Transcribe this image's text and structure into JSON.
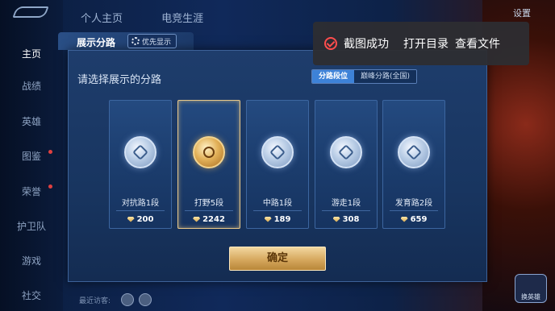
{
  "nav": {
    "items": [
      {
        "label": "主页",
        "active": true
      },
      {
        "label": "战绩",
        "active": false
      },
      {
        "label": "英雄",
        "active": false
      },
      {
        "label": "图鉴",
        "active": false
      },
      {
        "label": "荣誉",
        "active": false
      },
      {
        "label": "护卫队",
        "active": false
      },
      {
        "label": "游戏",
        "active": false
      },
      {
        "label": "社交",
        "active": false
      }
    ]
  },
  "top_tabs": [
    "个人主页",
    "电竞生涯"
  ],
  "top_right": {
    "settings_label": "设置"
  },
  "bottom": {
    "recent_visitors_label": "最近访客:"
  },
  "right_icon": {
    "label": "换英雄"
  },
  "modal": {
    "title": "展示分路",
    "priority_label": "优先显示",
    "prompt": "请选择展示的分路",
    "segments": [
      {
        "label": "分路段位",
        "active": true
      },
      {
        "label": "巅峰分路(全国)",
        "active": false
      }
    ],
    "cards": [
      {
        "label": "对抗路1段",
        "score": "200",
        "selected": false,
        "emblem": "fighter-lane-emblem-icon"
      },
      {
        "label": "打野5段",
        "score": "2242",
        "selected": true,
        "emblem": "jungle-emblem-icon"
      },
      {
        "label": "中路1段",
        "score": "189",
        "selected": false,
        "emblem": "mid-lane-emblem-icon"
      },
      {
        "label": "游走1段",
        "score": "308",
        "selected": false,
        "emblem": "roam-emblem-icon"
      },
      {
        "label": "发育路2段",
        "score": "659",
        "selected": false,
        "emblem": "farm-lane-emblem-icon"
      }
    ],
    "confirm_label": "确定"
  },
  "toast": {
    "message": "截图成功",
    "open_folder": "打开目录",
    "view_file": "查看文件",
    "icon_color": "#ff4d4d"
  }
}
